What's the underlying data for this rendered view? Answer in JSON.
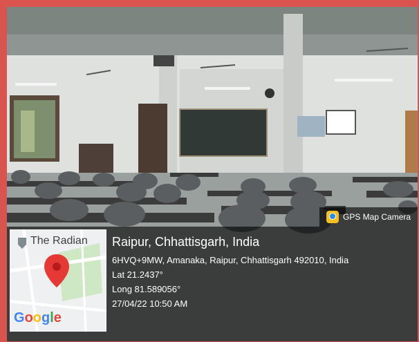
{
  "overlay": {
    "badge_label": "GPS Map Camera",
    "location_title": "Raipur, Chhattisgarh, India",
    "address": "6HVQ+9MW, Amanaka, Raipur, Chhattisgarh 492010, India",
    "latitude": "Lat 21.2437°",
    "longitude": "Long 81.589056°",
    "timestamp": "27/04/22 10:50 AM"
  },
  "map": {
    "place_label": "The Radian",
    "provider": "Google"
  },
  "colors": {
    "frame": "#d9534f",
    "overlay": "rgba(0,0,0,0.62)",
    "pin": "#e53935"
  }
}
